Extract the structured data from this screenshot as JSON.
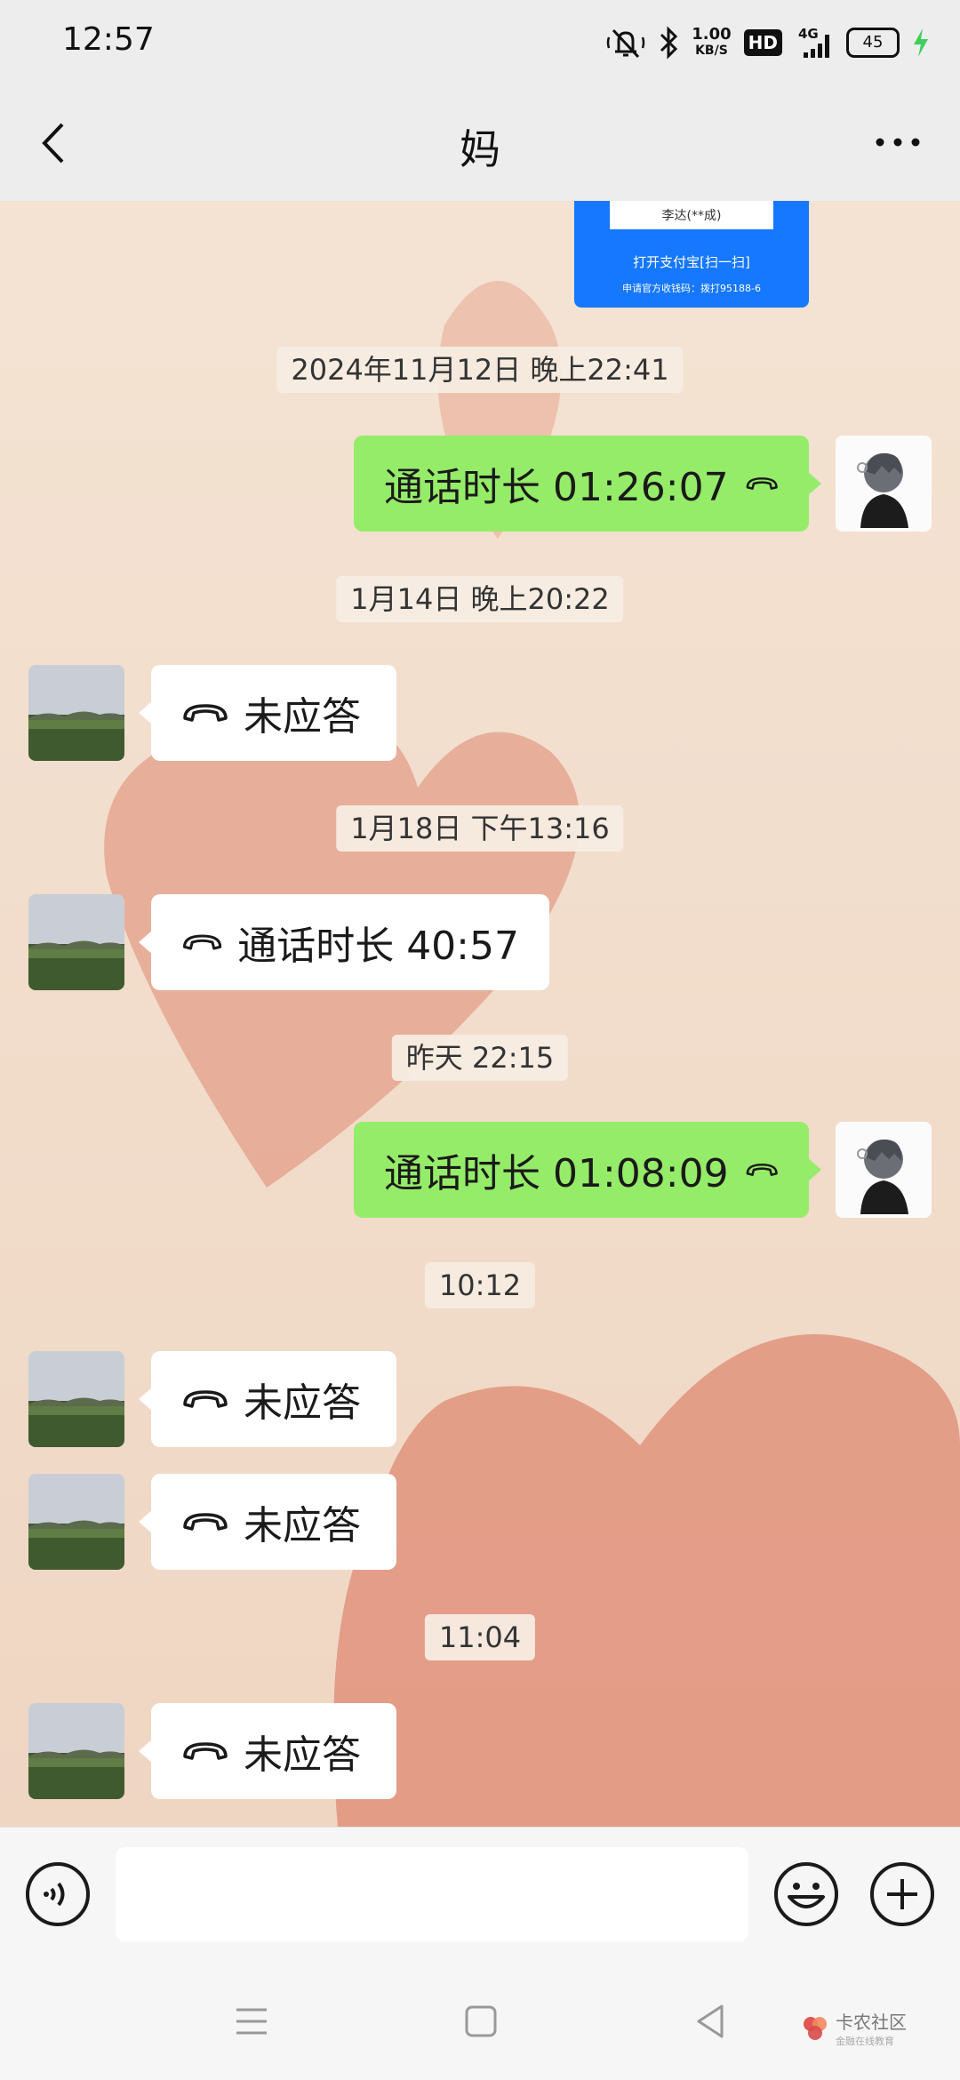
{
  "status_bar": {
    "time": "12:57",
    "net_speed_value": "1.00",
    "net_speed_unit": "KB/S",
    "hd_label": "HD",
    "signal_label": "4G",
    "battery": "45"
  },
  "header": {
    "title": "妈"
  },
  "top_card": {
    "name": "李达(**成)",
    "action": "打开支付宝[扫一扫]",
    "note": "申请官方收钱码：拨打95188-6"
  },
  "messages": [
    {
      "type": "timestamp",
      "text": "2024年11月12日 晚上22:41"
    },
    {
      "type": "call",
      "direction": "out",
      "text": "通话时长 01:26:07"
    },
    {
      "type": "timestamp",
      "text": "1月14日 晚上20:22"
    },
    {
      "type": "call",
      "direction": "in",
      "text": "未应答"
    },
    {
      "type": "timestamp",
      "text": "1月18日 下午13:16"
    },
    {
      "type": "call",
      "direction": "in",
      "text": "通话时长 40:57"
    },
    {
      "type": "timestamp",
      "text": "昨天 22:15"
    },
    {
      "type": "call",
      "direction": "out",
      "text": "通话时长 01:08:09"
    },
    {
      "type": "timestamp",
      "text": "10:12"
    },
    {
      "type": "call",
      "direction": "in",
      "text": "未应答"
    },
    {
      "type": "call",
      "direction": "in",
      "text": "未应答"
    },
    {
      "type": "timestamp",
      "text": "11:04"
    },
    {
      "type": "call",
      "direction": "in",
      "text": "未应答"
    }
  ],
  "input": {
    "placeholder": ""
  },
  "watermark": {
    "line1": "卡农社区",
    "line2": "金融在线教育"
  },
  "colors": {
    "outgoing_bubble": "#95ec69",
    "incoming_bubble": "#ffffff",
    "chat_background": "#f3dfcd"
  }
}
